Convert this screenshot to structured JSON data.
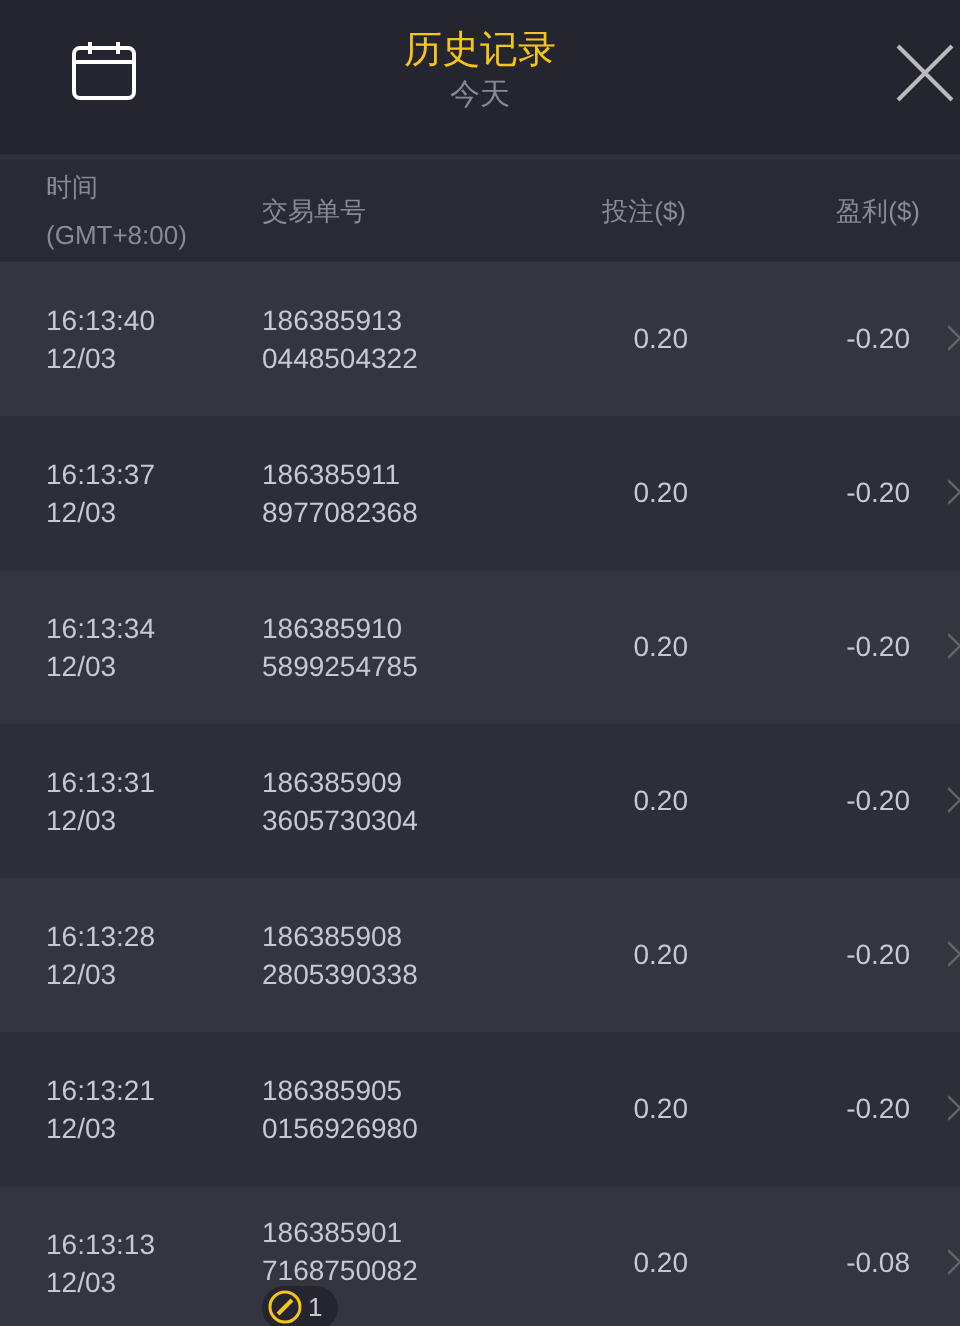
{
  "header": {
    "title": "历史记录",
    "subtitle": "今天"
  },
  "columns": {
    "time": "时间",
    "timezone": "(GMT+8:00)",
    "order": "交易单号",
    "bet": "投注($)",
    "profit": "盈利($)"
  },
  "rows": [
    {
      "time": "16:13:40",
      "date": "12/03",
      "order_1": "186385913",
      "order_2": "0448504322",
      "bet": "0.20",
      "profit": "-0.20"
    },
    {
      "time": "16:13:37",
      "date": "12/03",
      "order_1": "186385911",
      "order_2": "8977082368",
      "bet": "0.20",
      "profit": "-0.20"
    },
    {
      "time": "16:13:34",
      "date": "12/03",
      "order_1": "186385910",
      "order_2": "5899254785",
      "bet": "0.20",
      "profit": "-0.20"
    },
    {
      "time": "16:13:31",
      "date": "12/03",
      "order_1": "186385909",
      "order_2": "3605730304",
      "bet": "0.20",
      "profit": "-0.20"
    },
    {
      "time": "16:13:28",
      "date": "12/03",
      "order_1": "186385908",
      "order_2": "2805390338",
      "bet": "0.20",
      "profit": "-0.20"
    },
    {
      "time": "16:13:21",
      "date": "12/03",
      "order_1": "186385905",
      "order_2": "0156926980",
      "bet": "0.20",
      "profit": "-0.20"
    },
    {
      "time": "16:13:13",
      "date": "12/03",
      "order_1": "186385901",
      "order_2": "7168750082",
      "bet": "0.20",
      "profit": "-0.08",
      "badge": "1"
    }
  ]
}
